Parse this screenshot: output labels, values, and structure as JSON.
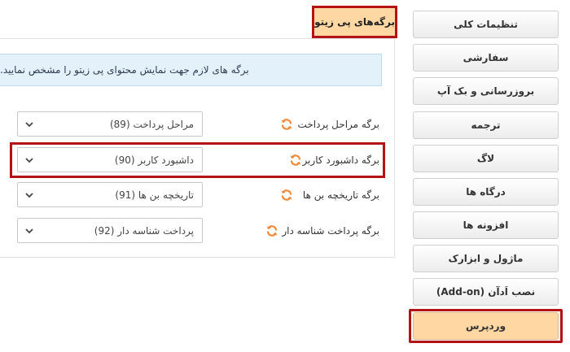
{
  "tab": {
    "label": "برگه‌های پی زیتو"
  },
  "info": {
    "text": "برگه های لازم جهت نمایش محتوای پی زیتو را مشخص نمایید."
  },
  "rows": [
    {
      "label": "برگه مراحل پرداخت",
      "value": "مراحل پرداخت (89)"
    },
    {
      "label": "برگه داشبورد کاربر",
      "value": "داشبورد کاربر (90)"
    },
    {
      "label": "برگه تاریخچه بن ها",
      "value": "تاریخچه بن ها (91)"
    },
    {
      "label": "برگه پرداخت شناسه دار",
      "value": "پرداخت شناسه دار (92)"
    }
  ],
  "sidebar": {
    "items": [
      {
        "label": "تنظیمات کلی"
      },
      {
        "label": "سفارشی"
      },
      {
        "label": "بروزرسانی و بک آپ"
      },
      {
        "label": "ترجمه"
      },
      {
        "label": "لاگ"
      },
      {
        "label": "درگاه ها"
      },
      {
        "label": "افزونه ها"
      },
      {
        "label": "ماژول و ابزارک"
      },
      {
        "label": "نصب اَدآن (Add-on)"
      },
      {
        "label": "وردپرس"
      }
    ],
    "active_index": 9
  },
  "colors": {
    "accent": "#ffd7a3",
    "highlight": "#b31217",
    "refresh_icon": "#f08a3c",
    "info_bg": "#e3f1fb"
  }
}
